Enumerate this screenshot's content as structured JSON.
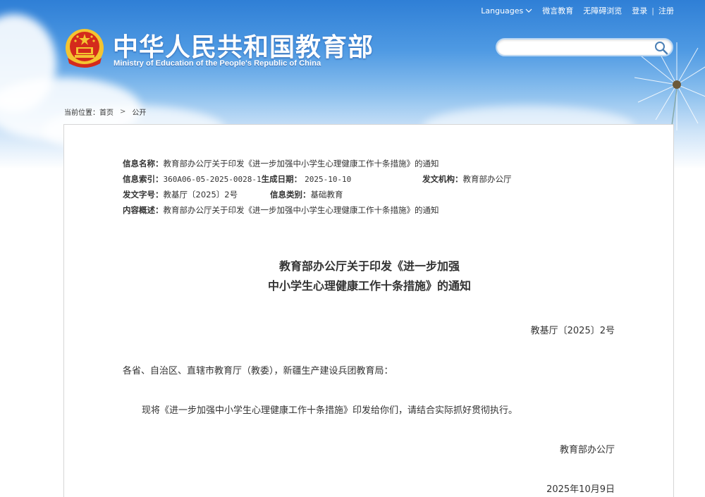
{
  "header": {
    "top_links": {
      "languages": "Languages",
      "weibo": "微言教育",
      "accessibility": "无障碍浏览",
      "login": "登录",
      "separator": "|",
      "register": "注册"
    },
    "title": "中华人民共和国教育部",
    "subtitle": "Ministry of Education of the People's Republic of China",
    "search": {
      "placeholder": "",
      "value": ""
    }
  },
  "breadcrumb": {
    "label": "当前位置：",
    "home": "首页",
    "chevron": ">",
    "current": "公开"
  },
  "meta": {
    "name_label": "信息名称：",
    "name_value": "教育部办公厅关于印发《进一步加强中小学生心理健康工作十条措施》的通知",
    "index_label": "信息索引：",
    "index_value": "360A06-05-2025-0028-1",
    "date_label": "生成日期：",
    "date_value": "2025-10-10",
    "issuer_label": "发文机构：",
    "issuer_value": "教育部办公厅",
    "docno_label": "发文字号：",
    "docno_value": "教基厅〔2025〕2号",
    "category_label": "信息类别：",
    "category_value": "基础教育",
    "summary_label": "内容概述：",
    "summary_value": "教育部办公厅关于印发《进一步加强中小学生心理健康工作十条措施》的通知"
  },
  "document": {
    "title_line1": "教育部办公厅关于印发《进一步加强",
    "title_line2": "中小学生心理健康工作十条措施》的通知",
    "number": "教基厅〔2025〕2号",
    "salutation": "各省、自治区、直辖市教育厅（教委），新疆生产建设兵团教育局：",
    "body": "现将《进一步加强中小学生心理健康工作十条措施》印发给你们，请结合实际抓好贯彻执行。",
    "signer": "教育部办公厅",
    "date": "2025年10月9日"
  },
  "colors": {
    "sky_top": "#2f7fd6",
    "emblem_red": "#d42a1c",
    "emblem_gold": "#f4c430",
    "text": "#333333",
    "border": "#d6d6d6"
  },
  "icons": [
    "emblem-icon",
    "chevron-down-icon",
    "search-icon",
    "dandelion-icon"
  ]
}
